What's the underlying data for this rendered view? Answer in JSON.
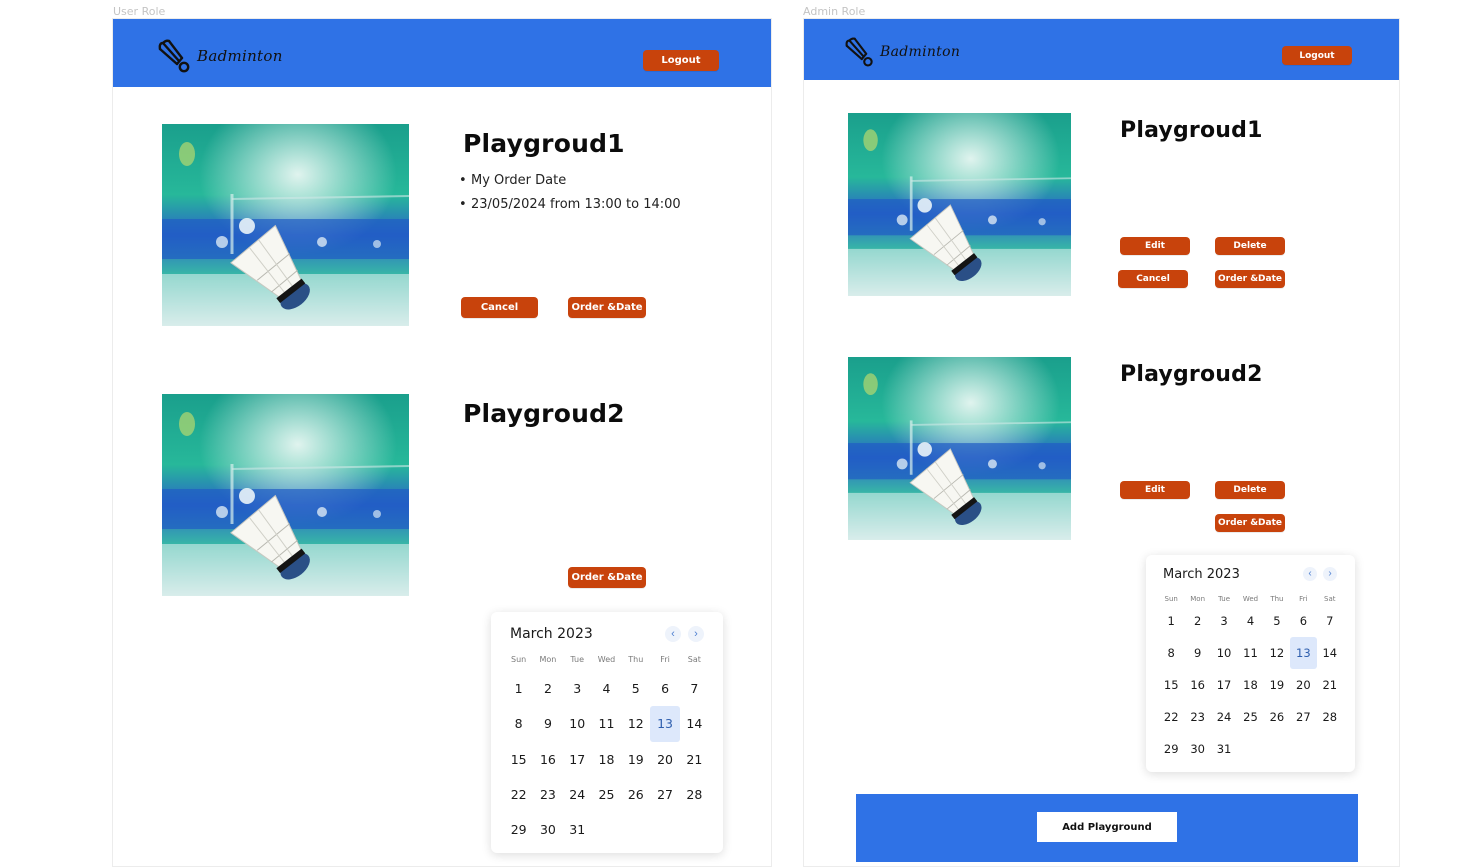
{
  "labels": {
    "user": "User Role",
    "admin": "Admin Role"
  },
  "brand": {
    "name": "Badminton"
  },
  "logout_label": "Logout",
  "user_view": {
    "playgrounds": [
      {
        "title": "Playgroud1",
        "bullets": [
          "My Order Date",
          "23/05/2024 from 13:00 to 14:00"
        ],
        "cancel_label": "Cancel",
        "order_label": "Order &Date"
      },
      {
        "title": "Playgroud2",
        "order_label": "Order &Date"
      }
    ]
  },
  "admin_view": {
    "playgrounds": [
      {
        "title": "Playgroud1",
        "edit_label": "Edit",
        "delete_label": "Delete",
        "cancel_label": "Cancel",
        "order_label": "Order &Date"
      },
      {
        "title": "Playgroud2",
        "edit_label": "Edit",
        "delete_label": "Delete",
        "order_label": "Order &Date"
      }
    ],
    "add_label": "Add Playground"
  },
  "calendar": {
    "month_label": "March 2023",
    "prev_icon": "‹",
    "next_icon": "›",
    "weekdays": [
      "Sun",
      "Mon",
      "Tue",
      "Wed",
      "Thu",
      "Fri",
      "Sat"
    ],
    "days": [
      "1",
      "2",
      "3",
      "4",
      "5",
      "6",
      "7",
      "8",
      "9",
      "10",
      "11",
      "12",
      "13",
      "14",
      "15",
      "16",
      "17",
      "18",
      "19",
      "20",
      "21",
      "22",
      "23",
      "24",
      "25",
      "26",
      "27",
      "28",
      "29",
      "30",
      "31"
    ],
    "selected_day": "13"
  },
  "colors": {
    "header_blue": "#2f72e6",
    "button_orange": "#c8430c",
    "selected_day_bg": "#dde8fb"
  }
}
